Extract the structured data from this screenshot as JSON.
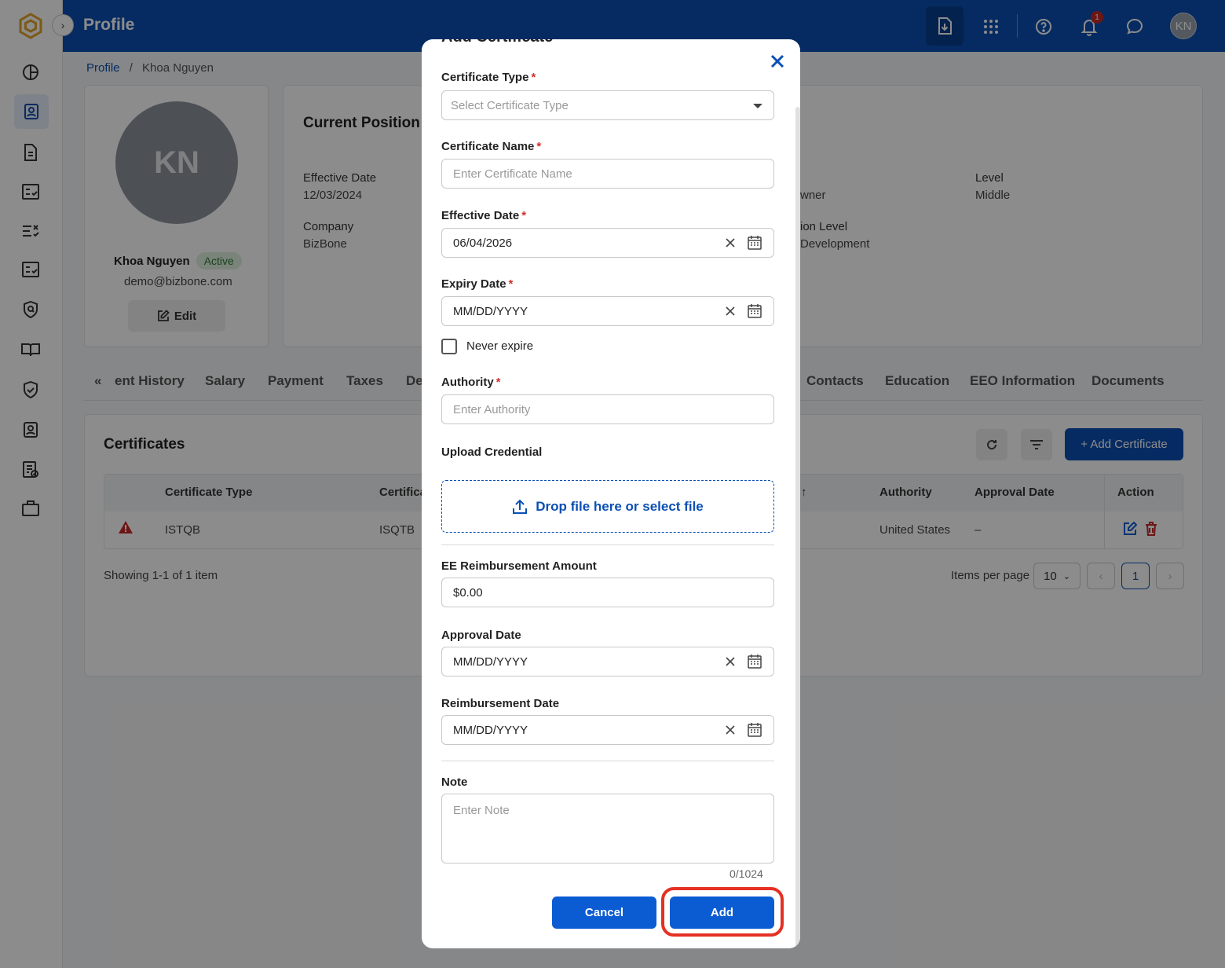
{
  "topbar": {
    "title": "Profile",
    "notification_count": "1",
    "user_initials": "KN"
  },
  "breadcrumb": {
    "root": "Profile",
    "separator": "/",
    "current": "Khoa Nguyen"
  },
  "profile_card": {
    "initials": "KN",
    "name": "Khoa Nguyen",
    "status": "Active",
    "email": "demo@bizbone.com",
    "edit_label": "Edit"
  },
  "position": {
    "title": "Current Position",
    "effective_date_label": "Effective Date",
    "effective_date_value": "12/03/2024",
    "company_label": "Company",
    "company_value": "BizBone",
    "owner_fragment": "wner",
    "level_fragment": "ion Level",
    "development_fragment": "Development",
    "level_label": "Level",
    "level_value": "Middle"
  },
  "tabs": {
    "prev_icon": "«",
    "items": [
      "ent History",
      "Salary",
      "Payment",
      "Taxes",
      "De",
      "Contacts",
      "Education",
      "EEO Information",
      "Documents"
    ]
  },
  "certificates": {
    "title": "Certificates",
    "add_label": "+ Add Certificate",
    "columns": [
      "Certificate Type",
      "Certifica",
      "Authority",
      "Approval Date",
      "Action"
    ],
    "rows": [
      {
        "type": "ISTQB",
        "name": "ISQTB",
        "authority": "United States",
        "approval_date": "–"
      }
    ],
    "showing": "Showing 1-1 of 1 item",
    "items_per_page_label": "Items per page",
    "items_per_page_value": "10",
    "current_page": "1"
  },
  "modal": {
    "heading": "Add Certificate",
    "certificate_type": {
      "label": "Certificate Type",
      "placeholder": "Select Certificate Type"
    },
    "certificate_name": {
      "label": "Certificate Name",
      "placeholder": "Enter Certificate Name"
    },
    "effective_date": {
      "label": "Effective Date",
      "value": "06/04/2026"
    },
    "expiry_date": {
      "label": "Expiry Date",
      "placeholder": "MM/DD/YYYY"
    },
    "never_expire": "Never expire",
    "authority": {
      "label": "Authority",
      "placeholder": "Enter Authority"
    },
    "upload": {
      "label": "Upload Credential",
      "dropzone": "Drop file here or select file"
    },
    "ee_reimbursement": {
      "label": "EE Reimbursement Amount",
      "value": "$0.00"
    },
    "approval_date": {
      "label": "Approval Date",
      "placeholder": "MM/DD/YYYY"
    },
    "reimbursement_date": {
      "label": "Reimbursement Date",
      "placeholder": "MM/DD/YYYY"
    },
    "note": {
      "label": "Note",
      "placeholder": "Enter Note",
      "counter": "0/1024"
    },
    "required_mark": "*",
    "cancel_label": "Cancel",
    "add_label": "Add"
  },
  "colors": {
    "primary": "#0b4fb3",
    "button": "#0b5bd3",
    "required": "#d32f2f",
    "highlight": "#e53124"
  }
}
